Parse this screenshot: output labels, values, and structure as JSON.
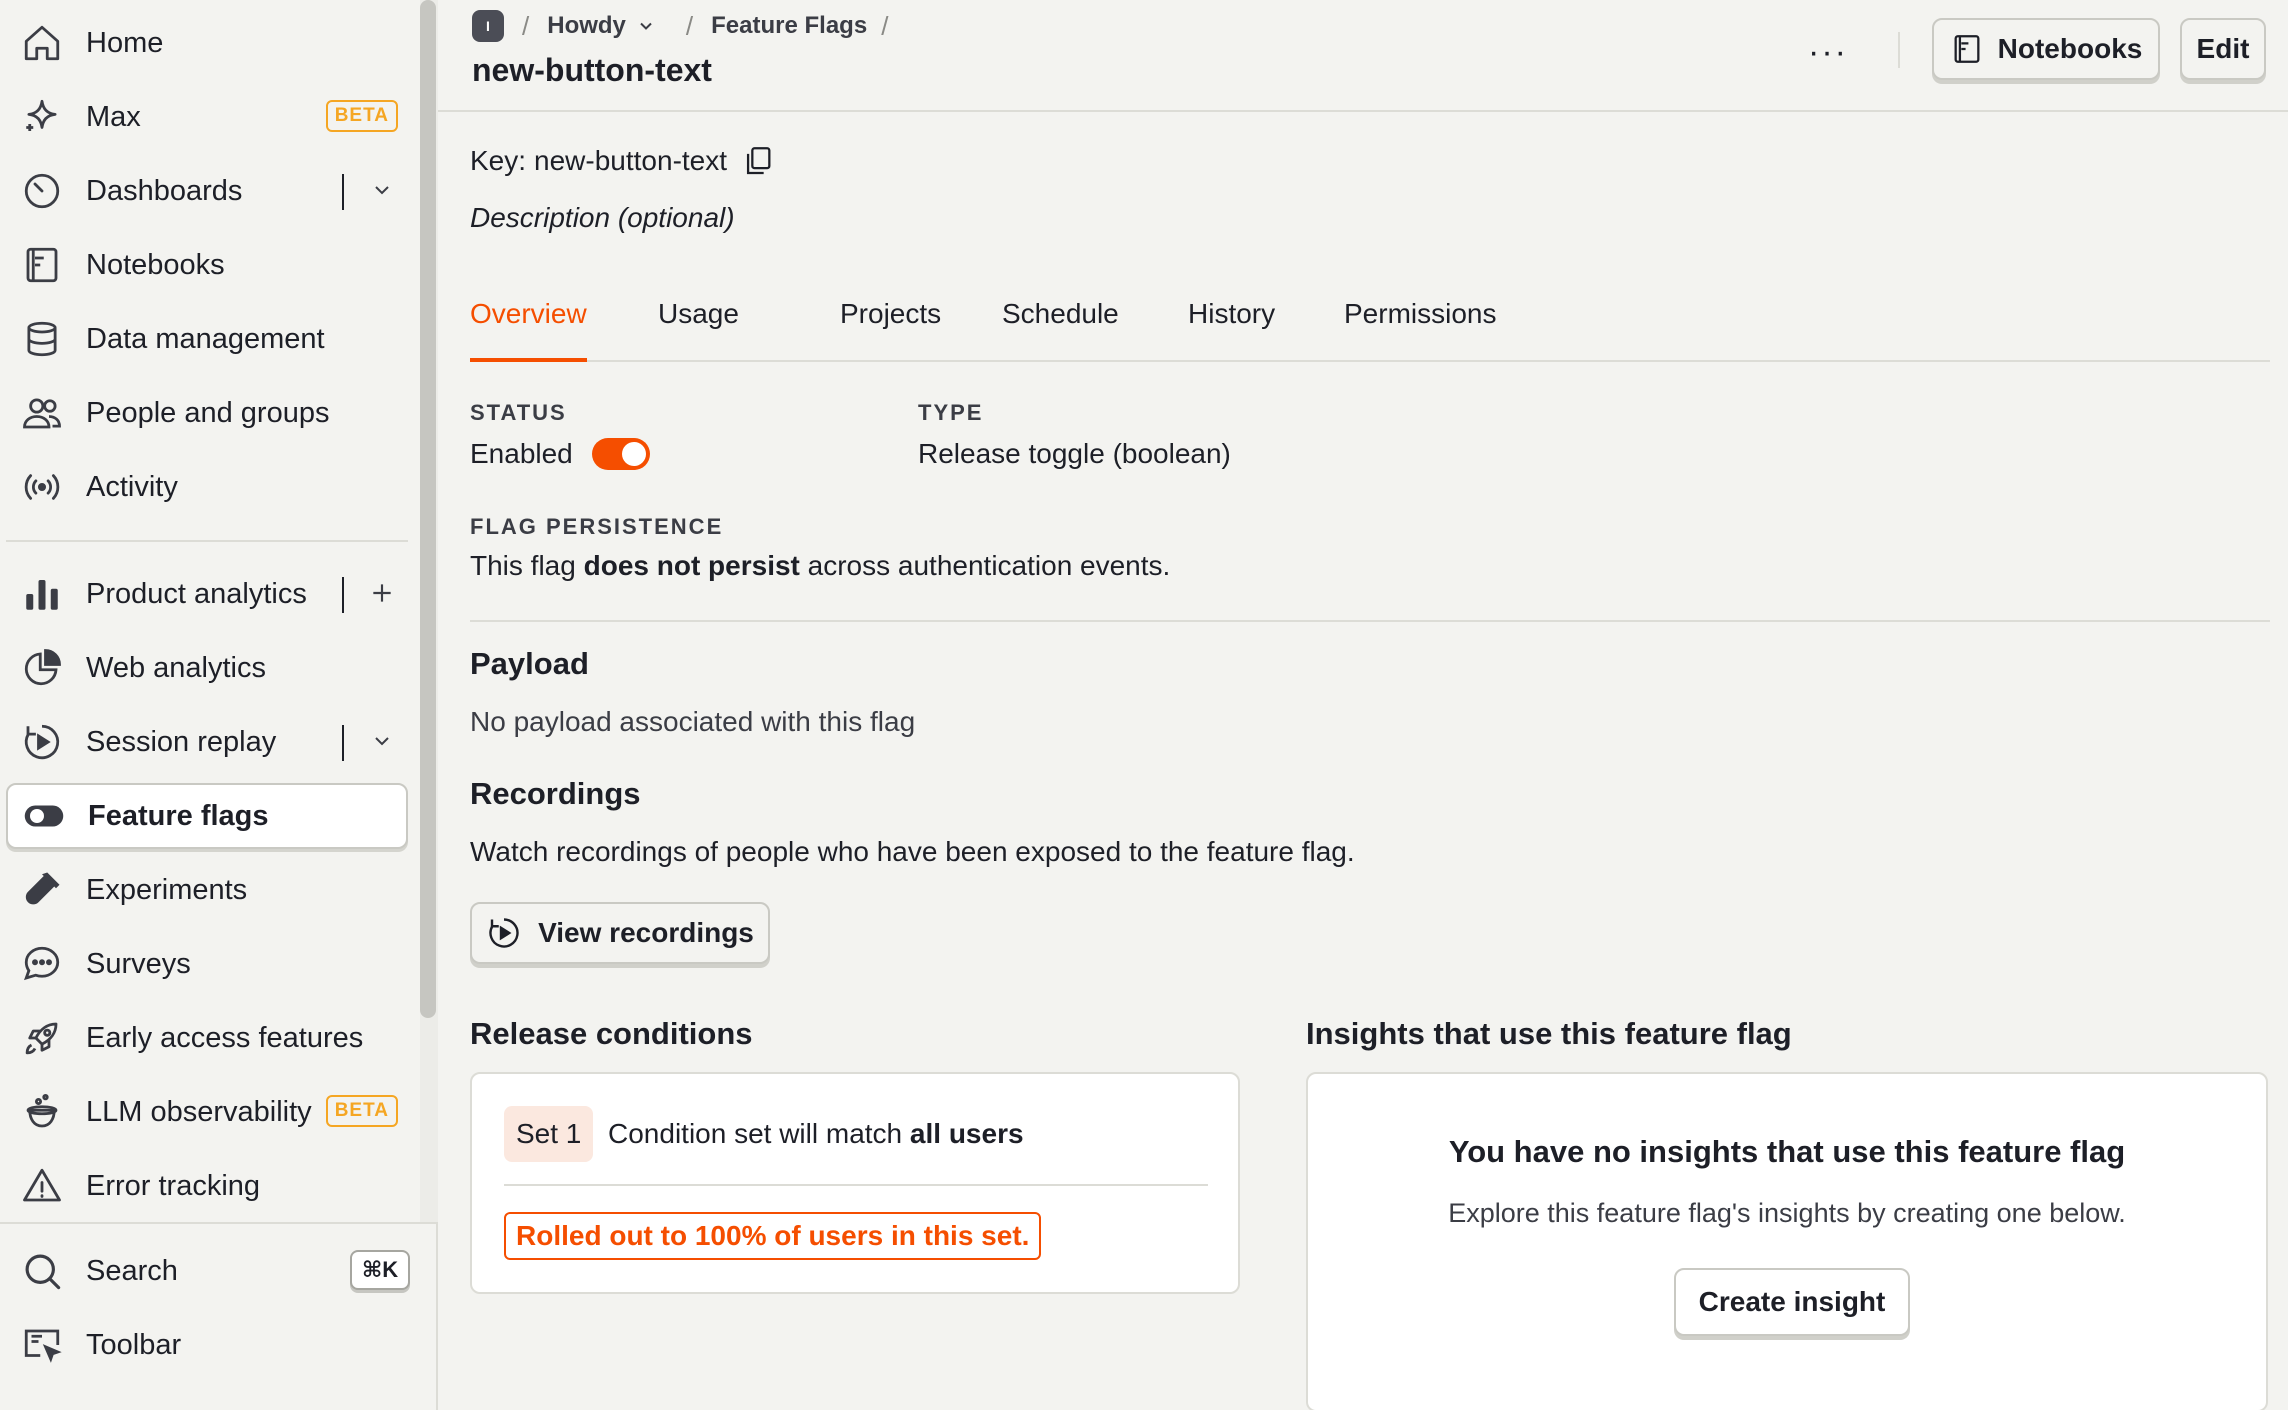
{
  "sidebar": {
    "items": [
      {
        "label": "Home",
        "icon": "home-icon"
      },
      {
        "label": "Max",
        "icon": "sparkle-icon",
        "badge": "BETA"
      },
      {
        "label": "Dashboards",
        "icon": "gauge-icon"
      },
      {
        "label": "Notebooks",
        "icon": "notebook-icon"
      },
      {
        "label": "Data management",
        "icon": "database-icon"
      },
      {
        "label": "People and groups",
        "icon": "people-icon"
      },
      {
        "label": "Activity",
        "icon": "broadcast-icon"
      },
      {
        "label": "Product analytics",
        "icon": "bar-chart-icon"
      },
      {
        "label": "Web analytics",
        "icon": "pie-chart-icon"
      },
      {
        "label": "Session replay",
        "icon": "replay-icon"
      },
      {
        "label": "Feature flags",
        "icon": "toggle-icon",
        "active": true
      },
      {
        "label": "Experiments",
        "icon": "flask-icon"
      },
      {
        "label": "Surveys",
        "icon": "chat-icon"
      },
      {
        "label": "Early access features",
        "icon": "rocket-icon"
      },
      {
        "label": "LLM observability",
        "icon": "cauldron-icon",
        "badge": "BETA"
      },
      {
        "label": "Error tracking",
        "icon": "warning-icon"
      }
    ],
    "bottom": {
      "search_label": "Search",
      "search_shortcut": "⌘K",
      "toolbar_label": "Toolbar"
    }
  },
  "header": {
    "breadcrumb": {
      "avatar": "I",
      "project": "Howdy",
      "section": "Feature Flags"
    },
    "title": "new-button-text",
    "more_label": "···",
    "notebooks_label": "Notebooks",
    "edit_label": "Edit"
  },
  "flag": {
    "key_label": "Key:",
    "key": "new-button-text",
    "description_placeholder": "Description (optional)"
  },
  "tabs": [
    "Overview",
    "Usage",
    "Projects",
    "Schedule",
    "History",
    "Permissions"
  ],
  "active_tab": "Overview",
  "overview": {
    "status_label": "STATUS",
    "status_value": "Enabled",
    "status_on": true,
    "type_label": "TYPE",
    "type_value": "Release toggle (boolean)",
    "persistence_label": "FLAG PERSISTENCE",
    "persistence_pre": "This flag",
    "persistence_bold": "does not persist",
    "persistence_post": "across authentication events.",
    "payload_title": "Payload",
    "payload_text": "No payload associated with this flag",
    "recordings_title": "Recordings",
    "recordings_text": "Watch recordings of people who have been exposed to the feature flag.",
    "view_recordings_label": "View recordings"
  },
  "release_conditions": {
    "title": "Release conditions",
    "set_label": "Set 1",
    "condition_pre": "Condition set will match",
    "condition_bold": "all users",
    "rollout_text": "Rolled out to 100% of users in this set."
  },
  "insights": {
    "title": "Insights that use this feature flag",
    "empty_title": "You have no insights that use this feature flag",
    "empty_text": "Explore this feature flag's insights by creating one below.",
    "create_label": "Create insight"
  },
  "colors": {
    "accent": "#f54e00",
    "beta": "#f5a623",
    "background": "#f3f3f0"
  }
}
